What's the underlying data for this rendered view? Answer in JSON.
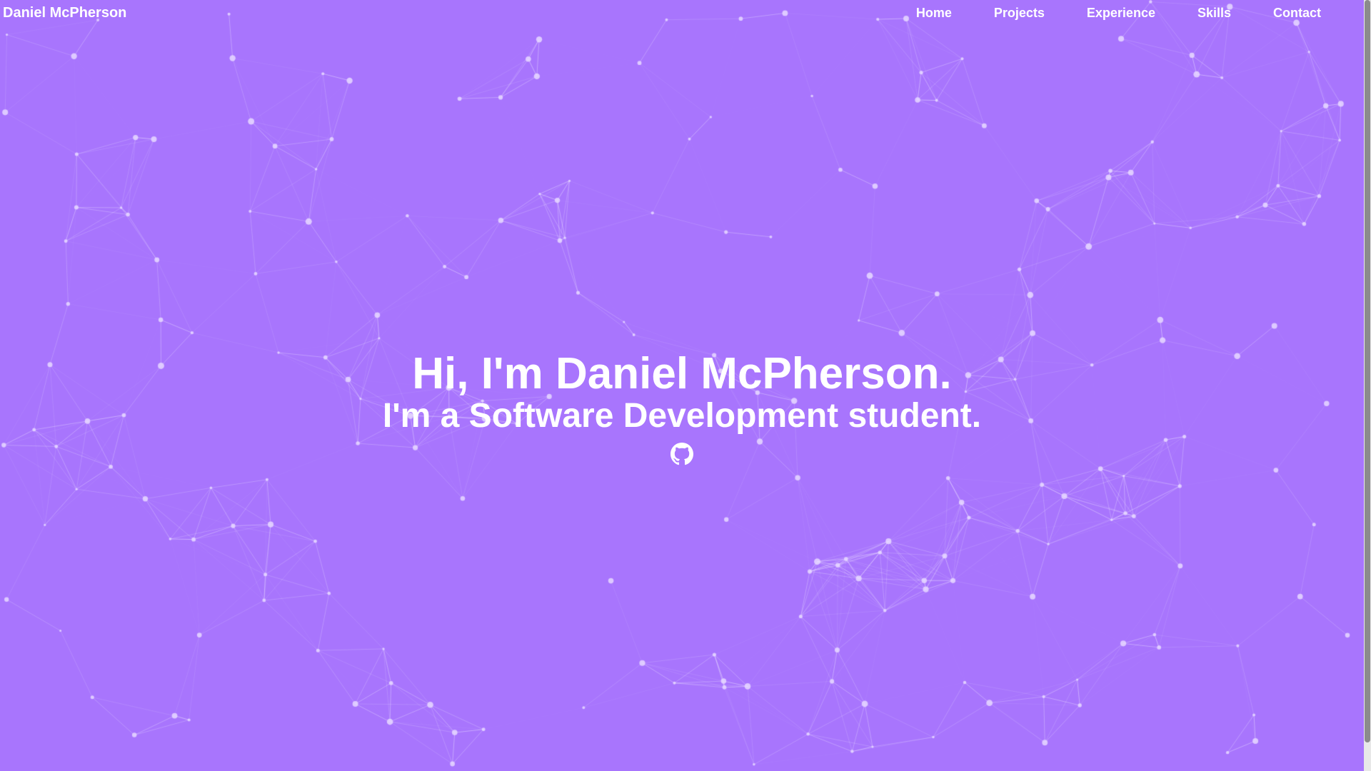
{
  "brand": "Daniel McPherson",
  "nav": {
    "home": "Home",
    "projects": "Projects",
    "experience": "Experience",
    "skills": "Skills",
    "contact": "Contact"
  },
  "hero": {
    "title": "Hi, I'm Daniel McPherson.",
    "subtitle": "I'm a Software Development student."
  },
  "icons": {
    "github": "github-icon"
  },
  "colors": {
    "background": "#a875fd",
    "text": "#ffffff",
    "particle": "#e6d8ff"
  }
}
